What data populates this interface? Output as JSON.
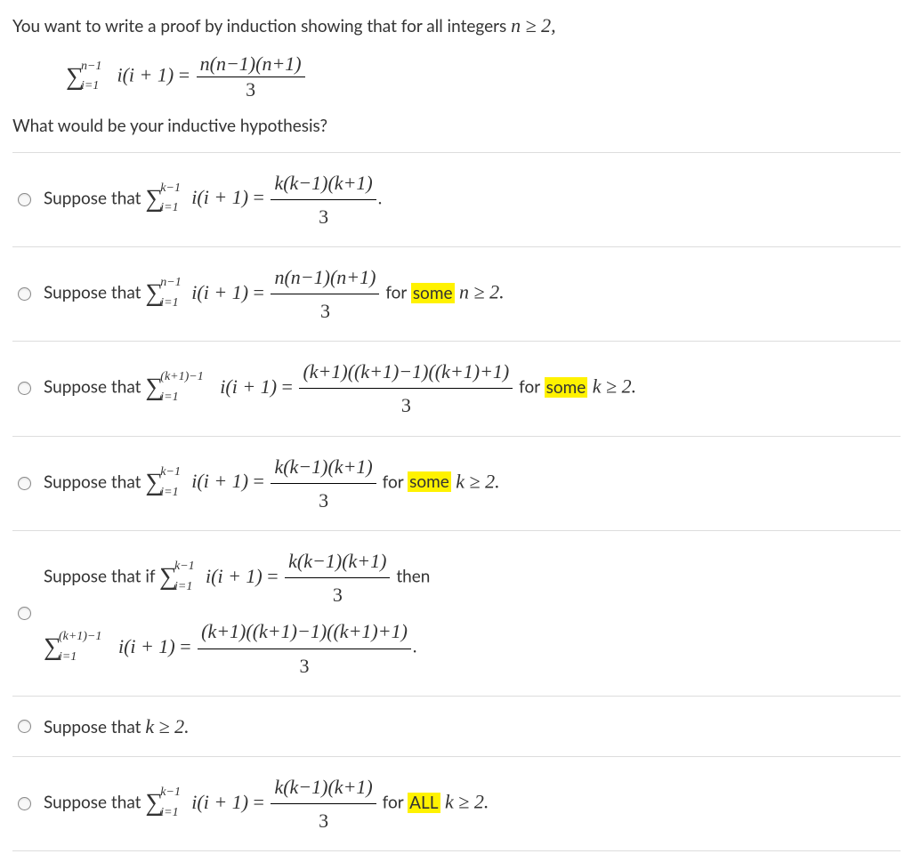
{
  "question": {
    "line1_a": "You want to write a proof by induction showing that for all integers ",
    "line1_math": "n ≥ 2,",
    "line2_a": "What would be your inductive hypothesis?"
  },
  "main_formula": {
    "sum_lower": "i=1",
    "sum_upper": "n−1",
    "term": "i(i + 1)",
    "eq": " = ",
    "frac_num": "n(n−1)(n+1)",
    "frac_den": "3"
  },
  "options": [
    {
      "prefix": "Suppose that ",
      "sum_lower": "i=1",
      "sum_upper": "k−1",
      "term": "i(i + 1)",
      "eq": " = ",
      "frac_num": "k(k−1)(k+1)",
      "frac_den": "3",
      "suffix_a": ".",
      "pad": "k"
    },
    {
      "prefix": "Suppose that ",
      "sum_lower": "i=1",
      "sum_upper": "n−1",
      "term": "i(i + 1)",
      "eq": " = ",
      "frac_num": "n(n−1)(n+1)",
      "frac_den": "3",
      "for_text": " for ",
      "hl": "some",
      "tail_math": " n ≥ 2.",
      "pad": "n"
    },
    {
      "prefix": "Suppose that ",
      "sum_lower": "i=1",
      "sum_upper": "(k+1)−1",
      "term": "i(i + 1)",
      "eq": " = ",
      "frac_num": "(k+1)((k+1)−1)((k+1)+1)",
      "frac_den": "3",
      "for_text": " for ",
      "hl": "some",
      "tail_math": " k ≥ 2.",
      "pad": "kp"
    },
    {
      "prefix": "Suppose that ",
      "sum_lower": "i=1",
      "sum_upper": "k−1",
      "term": "i(i + 1)",
      "eq": " = ",
      "frac_num": "k(k−1)(k+1)",
      "frac_den": "3",
      "for_text": " for ",
      "hl": "some",
      "tail_math": " k ≥ 2.",
      "pad": "k"
    },
    {
      "prefix": "Suppose that if ",
      "sum_lower": "i=1",
      "sum_upper": "k−1",
      "term": "i(i + 1)",
      "eq": " = ",
      "frac_num": "k(k−1)(k+1)",
      "frac_den": "3",
      "suffix_a": " then",
      "pad": "k",
      "second_line": {
        "sum_lower": "i=1",
        "sum_upper": "(k+1)−1",
        "term": "i(i + 1)",
        "eq": " = ",
        "frac_num": "(k+1)((k+1)−1)((k+1)+1)",
        "frac_den": "3",
        "suffix_a": ".",
        "pad": "kp"
      }
    },
    {
      "prefix": "Suppose that ",
      "plain_math": "k ≥ 2."
    },
    {
      "prefix": "Suppose that ",
      "sum_lower": "i=1",
      "sum_upper": "k−1",
      "term": "i(i + 1)",
      "eq": " = ",
      "frac_num": "k(k−1)(k+1)",
      "frac_den": "3",
      "for_text": " for ",
      "hl": "ALL",
      "tail_math": " k ≥ 2.",
      "pad": "k"
    }
  ]
}
